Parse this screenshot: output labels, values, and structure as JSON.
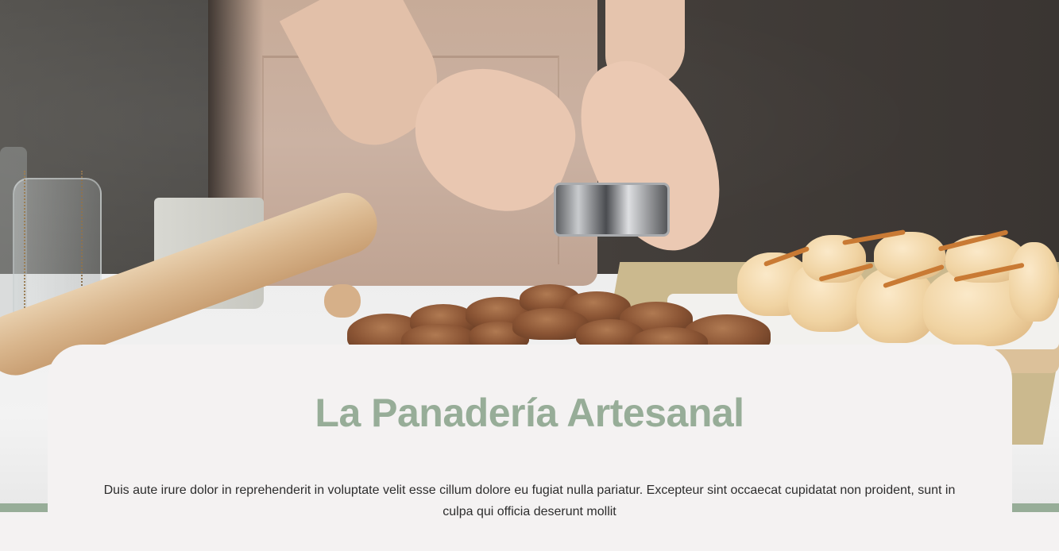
{
  "hero": {
    "image_description": "Baker in beige apron holding a metal ring cutter over cocoa-dusted pastries, rolling pin, jars, mug and glazed buns on a wooden board"
  },
  "main": {
    "title": "La Panadería Artesanal",
    "body": "Duis aute irure dolor in reprehenderit in voluptate velit esse cillum dolore eu fugiat nulla pariatur. Excepteur sint occaecat cupidatat non proident, sunt in culpa qui officia deserunt mollit"
  },
  "colors": {
    "accent": "#97ad98",
    "card_background": "#f4f2f2",
    "text": "#2d2d2d"
  }
}
